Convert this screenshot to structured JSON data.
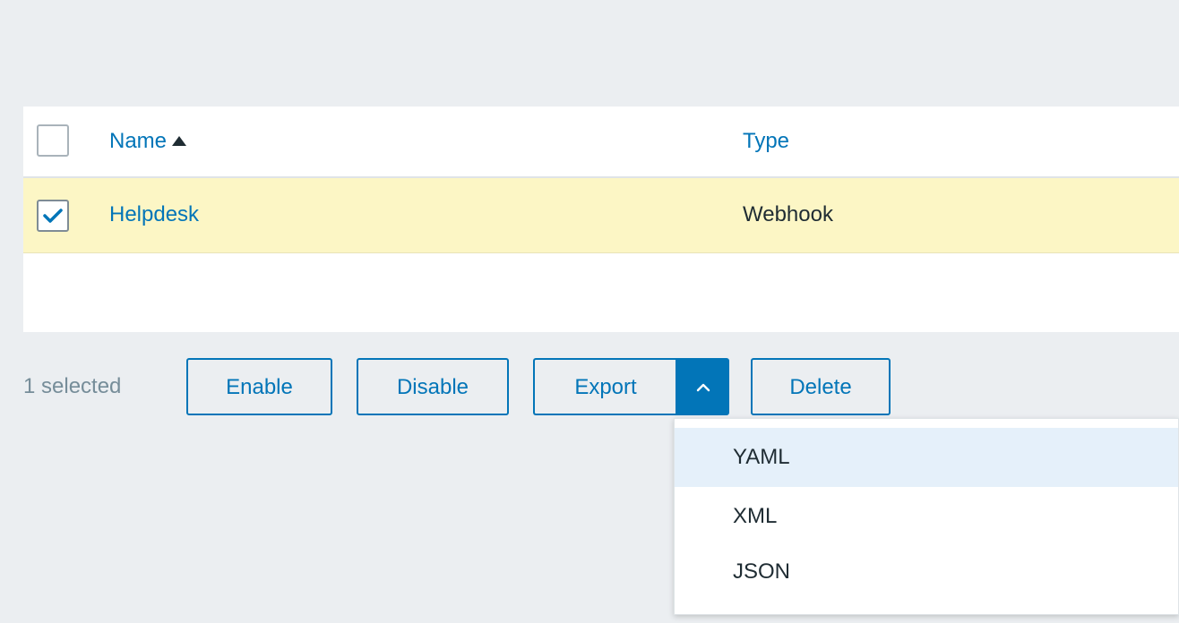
{
  "table": {
    "columns": {
      "name": "Name",
      "type": "Type"
    },
    "rows": [
      {
        "name": "Helpdesk",
        "type": "Webhook",
        "checked": true
      }
    ]
  },
  "actions": {
    "selected_count": "1 selected",
    "enable": "Enable",
    "disable": "Disable",
    "export": "Export",
    "delete": "Delete"
  },
  "export_menu": {
    "items": [
      "YAML",
      "XML",
      "JSON"
    ]
  },
  "icons": {
    "sort": "sort-ascending-icon",
    "checkbox_checked": "check-icon",
    "export_toggle": "chevron-up-icon"
  },
  "colors": {
    "accent": "#0275b8",
    "selected_row": "#fcf6c5",
    "menu_hover": "#e5f0fa",
    "background": "#ebeef1"
  }
}
